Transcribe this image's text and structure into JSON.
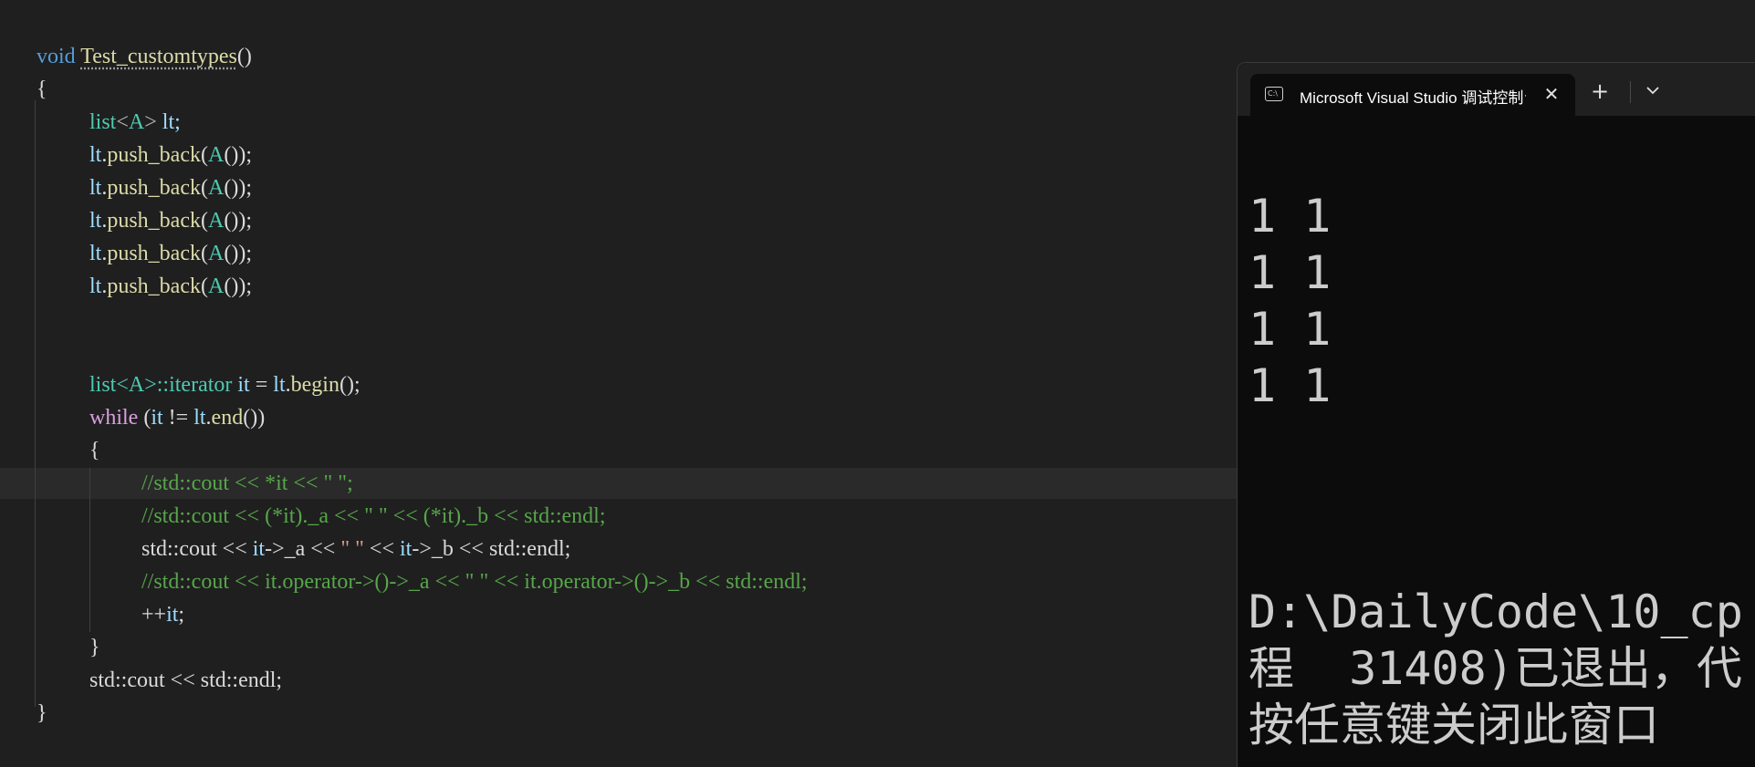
{
  "editor": {
    "function_keyword": "void",
    "function_name": "Test_customtypes",
    "lines": {
      "l1_paren": "()",
      "l2": "{",
      "l3_type": "list",
      "l3_lt": "<",
      "l3_A": "A",
      "l3_gt": ">",
      "l3_var": " lt;",
      "push_obj": "lt",
      "push_dot": ".",
      "push_fn": "push_back",
      "push_open": "(",
      "push_A": "A",
      "push_close": "());",
      "l11_type": "list",
      "l11_tmpl": "<A>::",
      "l11_iter": "iterator",
      "l11_var": " it ",
      "l11_eq": "= ",
      "l11_lt": "lt",
      "l11_dot": ".",
      "l11_begin": "begin",
      "l11_end": "();",
      "l12_kw": "while",
      "l12_open": " (",
      "l12_it": "it",
      "l12_ne": " != ",
      "l12_lt": "lt",
      "l12_dot": ".",
      "l12_end": "end",
      "l12_close": "())",
      "l13": "{",
      "l14": "//std::cout << *it << \" \";",
      "l15": "//std::cout << (*it)._a << \" \" << (*it)._b << std::endl;",
      "l16_a": "std::cout << ",
      "l16_it1": "it",
      "l16_b": "->_a << ",
      "l16_str": "\" \"",
      "l16_c": " << ",
      "l16_it2": "it",
      "l16_d": "->_b << std::endl;",
      "l17": "//std::cout << it.operator->()->_a << \" \" << it.operator->()->_b << std::endl;",
      "l18_pp": "++",
      "l18_it": "it",
      "l18_semi": ";",
      "l19": "}",
      "l20": "std::cout << std::endl;",
      "l21": "}"
    }
  },
  "console": {
    "tab_title": "Microsoft Visual Studio 调试控制台",
    "icon_label": "C:\\",
    "close_glyph": "✕",
    "new_tab_glyph": "+",
    "output": [
      "1 1",
      "1 1",
      "1 1",
      "1 1",
      "",
      "",
      "D:\\DailyCode\\10_cp",
      "程  31408)已退出，代",
      "按任意键关闭此窗口"
    ]
  },
  "colors": {
    "editor_bg": "#1f1f1f",
    "console_bg": "#0c0c0c",
    "keyword": "#569cd6",
    "control_keyword": "#d8a0df",
    "function": "#dcdcaa",
    "type": "#4ec9b0",
    "identifier": "#9cdcfe",
    "comment": "#57a64a",
    "string": "#d69d85"
  }
}
